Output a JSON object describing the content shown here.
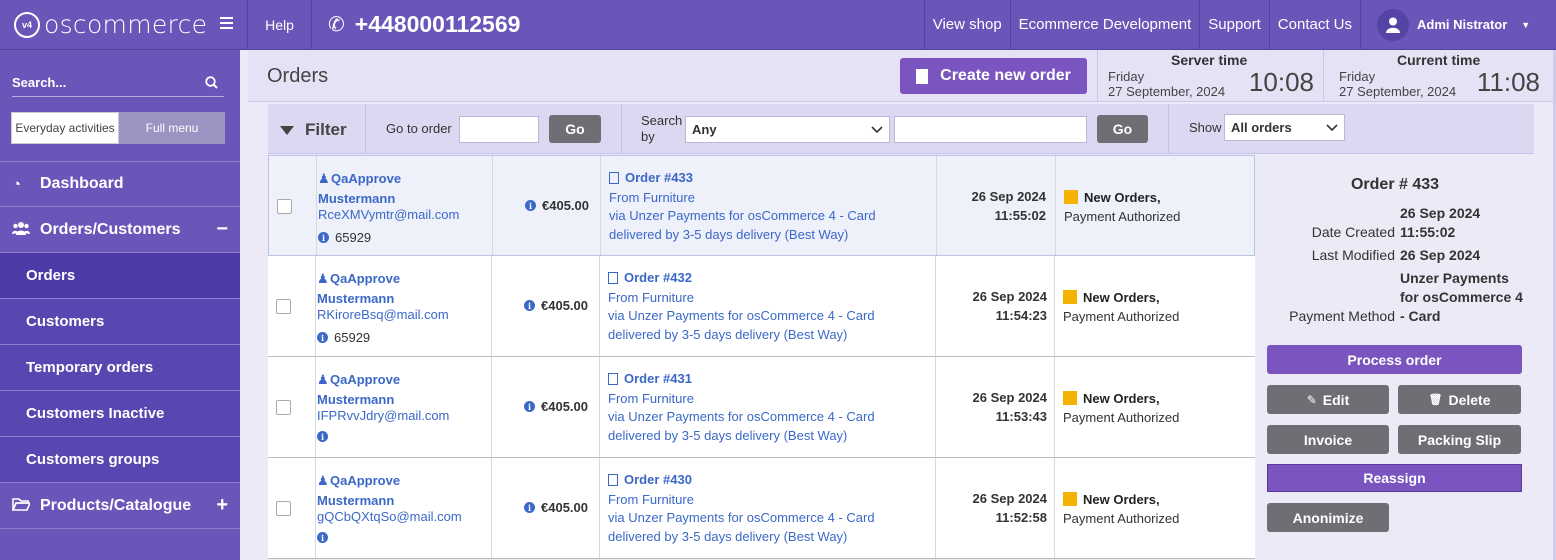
{
  "topbar": {
    "logo_badge": "v4",
    "logo_text": "oscommerce",
    "help": "Help",
    "phone": "+448000112569",
    "links": [
      "View shop",
      "Ecommerce Development",
      "Support",
      "Contact Us"
    ],
    "user": "Admi Nistrator"
  },
  "sidebar": {
    "search_placeholder": "Search...",
    "mode_everyday": "Everyday activities",
    "mode_full": "Full menu",
    "dashboard": "Dashboard",
    "orders_customers": "Orders/Customers",
    "sub_items": [
      "Orders",
      "Customers",
      "Temporary orders",
      "Customers Inactive",
      "Customers groups"
    ],
    "products_catalogue": "Products/Catalogue"
  },
  "header": {
    "title": "Orders",
    "create_button": "Create new order",
    "server_time": {
      "label": "Server time",
      "day": "Friday",
      "date": "27 September, 2024",
      "time": "10:08"
    },
    "current_time": {
      "label": "Current time",
      "day": "Friday",
      "date": "27 September, 2024",
      "time": "11:08"
    }
  },
  "filter": {
    "title": "Filter",
    "go_to_order_label": "Go to order",
    "go_label": "Go",
    "search_by_label_1": "Search",
    "search_by_label_2": "by",
    "search_by_value": "Any",
    "show_label": "Show",
    "show_value": "All orders"
  },
  "orders": [
    {
      "first": "QaApprove",
      "last": "Mustermann",
      "email": "RceXMVymtr@mail.com",
      "id": "65929",
      "amount": "€405.00",
      "order": "Order #433",
      "from": "From Furniture",
      "via": "via Unzer Payments for osCommerce 4 - Card",
      "delivery": "delivered by 3-5 days delivery (Best Way)",
      "date": "26 Sep 2024",
      "time": "11:55:02",
      "status": "New Orders,",
      "sub_status": "Payment Authorized"
    },
    {
      "first": "QaApprove",
      "last": "Mustermann",
      "email": "RKiroreBsq@mail.com",
      "id": "65929",
      "amount": "€405.00",
      "order": "Order #432",
      "from": "From Furniture",
      "via": "via Unzer Payments for osCommerce 4 - Card",
      "delivery": "delivered by 3-5 days delivery (Best Way)",
      "date": "26 Sep 2024",
      "time": "11:54:23",
      "status": "New Orders,",
      "sub_status": "Payment Authorized"
    },
    {
      "first": "QaApprove",
      "last": "Mustermann",
      "email": "IFPRvvJdry@mail.com",
      "id": "",
      "amount": "€405.00",
      "order": "Order #431",
      "from": "From Furniture",
      "via": "via Unzer Payments for osCommerce 4 - Card",
      "delivery": "delivered by 3-5 days delivery (Best Way)",
      "date": "26 Sep 2024",
      "time": "11:53:43",
      "status": "New Orders,",
      "sub_status": "Payment Authorized"
    },
    {
      "first": "QaApprove",
      "last": "Mustermann",
      "email": "gQCbQXtqSo@mail.com",
      "id": "",
      "amount": "€405.00",
      "order": "Order #430",
      "from": "From Furniture",
      "via": "via Unzer Payments for osCommerce 4 - Card",
      "delivery": "delivered by 3-5 days delivery (Best Way)",
      "date": "26 Sep 2024",
      "time": "11:52:58",
      "status": "New Orders,",
      "sub_status": "Payment Authorized"
    }
  ],
  "details": {
    "title": "Order # 433",
    "date_created_label": "Date Created",
    "date_created_date": "26 Sep 2024",
    "date_created_time": "11:55:02",
    "last_modified_label": "Last Modified",
    "last_modified": "26 Sep 2024",
    "payment_method_label": "Payment Method",
    "payment_method_1": "Unzer Payments",
    "payment_method_2": "for osCommerce 4",
    "payment_method_3": "- Card",
    "process": "Process order",
    "edit": "Edit",
    "delete": "Delete",
    "invoice": "Invoice",
    "packing_slip": "Packing Slip",
    "reassign": "Reassign",
    "anonimize": "Anonimize"
  },
  "colors": {
    "brand": "#6a56b8",
    "accent": "#7a55c0",
    "link": "#3b68c7",
    "status": "#f5b301"
  }
}
